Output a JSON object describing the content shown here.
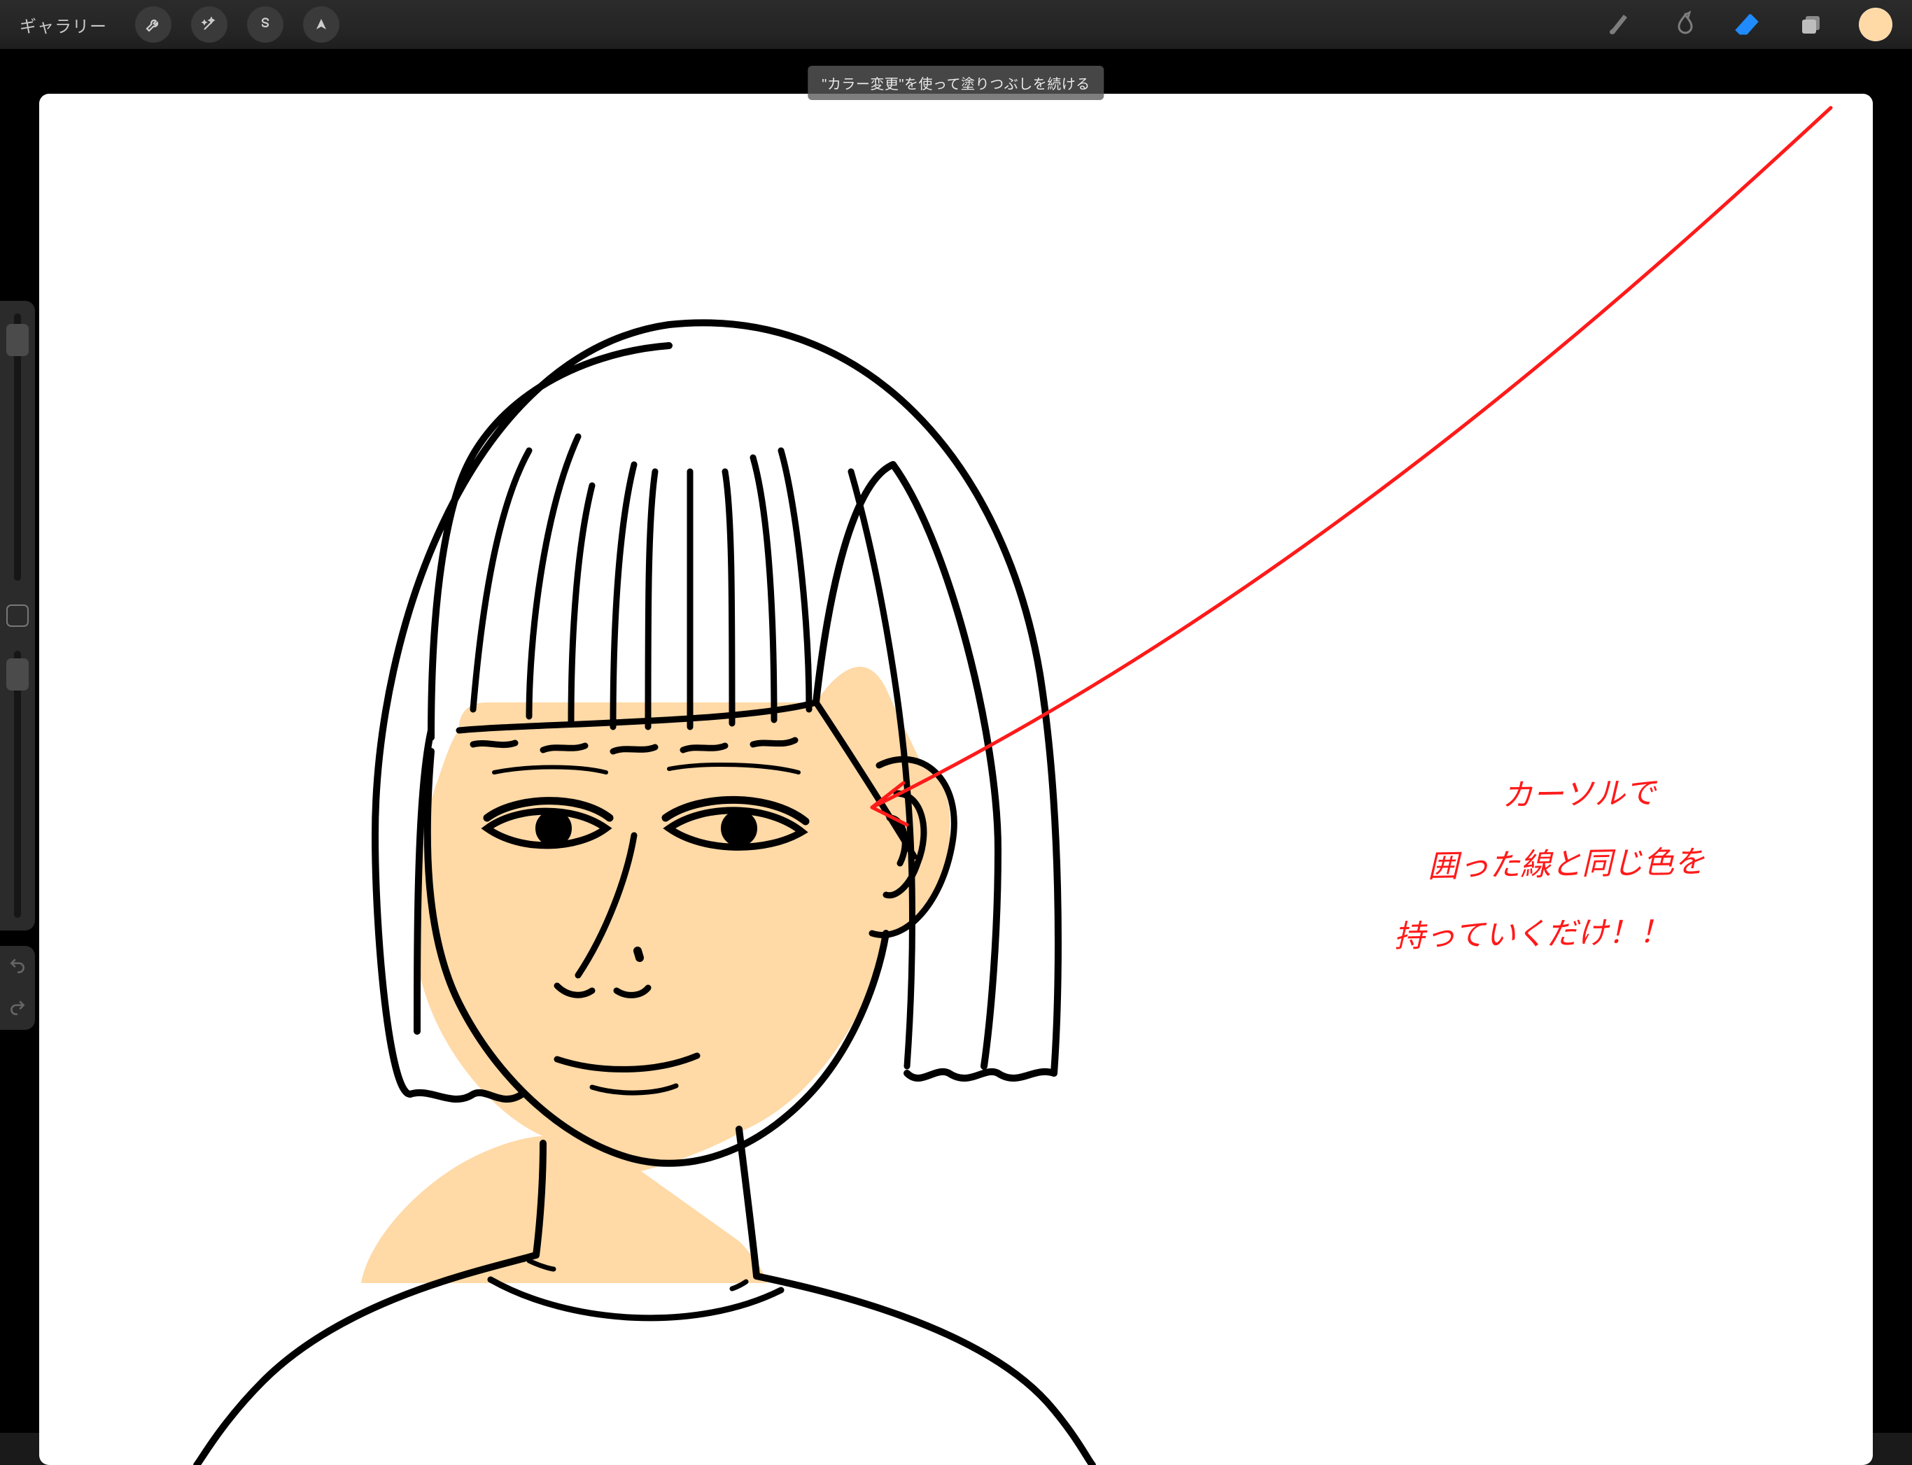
{
  "toolbar": {
    "gallery_label": "ギャラリー",
    "left_tools": [
      {
        "name": "wrench-icon"
      },
      {
        "name": "wand-icon"
      },
      {
        "name": "selection-s-icon"
      },
      {
        "name": "cursor-arrow-icon"
      }
    ],
    "right_tools": [
      {
        "name": "brush-icon",
        "active": false
      },
      {
        "name": "smudge-icon",
        "active": false
      },
      {
        "name": "eraser-icon",
        "active": true
      },
      {
        "name": "layers-icon",
        "active": false
      }
    ],
    "current_color": "#ffd9a6"
  },
  "toast": {
    "text": "\"カラー変更\"を使って塗りつぶしを続ける"
  },
  "sidebar": {
    "brush_size_slider": {
      "thumb_position_pct": 5
    },
    "opacity_slider": {
      "thumb_position_pct": 4
    }
  },
  "canvas": {
    "skin_fill_color": "#ffd9a6",
    "stroke_color": "#000000",
    "annotation_color": "#ff1a1a",
    "annotation_lines": [
      "カーソルで",
      "囲った線と同じ色を",
      "持っていくだけ！！"
    ]
  }
}
